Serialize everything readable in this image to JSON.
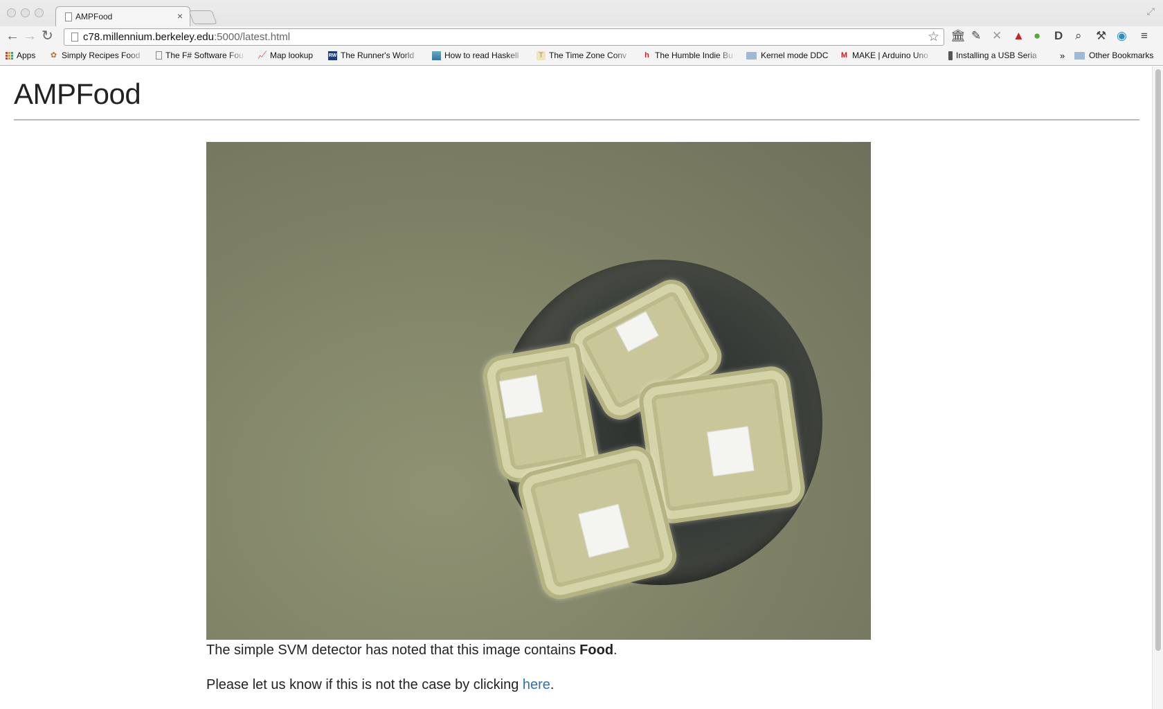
{
  "browser": {
    "tab_title": "AMPFood",
    "tab_close": "×",
    "url_host": "c78.millennium.berkeley.edu",
    "url_path": ":5000/latest.html",
    "bookmarks": [
      {
        "label": "Apps",
        "icon": "apps-grid-icon"
      },
      {
        "label": "Simply Recipes Food",
        "icon": "flower-icon"
      },
      {
        "label": "The F# Software Fou",
        "icon": "page-icon"
      },
      {
        "label": "Map lookup",
        "icon": "chart-icon"
      },
      {
        "label": "The Runner's World",
        "icon": "rw-icon"
      },
      {
        "label": "How to read Haskell",
        "icon": "image-icon"
      },
      {
        "label": "The Time Zone Conv",
        "icon": "clock-icon"
      },
      {
        "label": "The Humble Indie Bu",
        "icon": "humble-icon"
      },
      {
        "label": "Kernel mode DDC",
        "icon": "folder-icon"
      },
      {
        "label": "MAKE | Arduino Uno",
        "icon": "make-icon"
      },
      {
        "label": "Installing a USB Seria",
        "icon": "usb-icon"
      },
      {
        "label": "Other Bookmarks",
        "icon": "folder-icon"
      }
    ],
    "overflow": "»"
  },
  "page": {
    "title": "AMPFood",
    "caption_prefix": "The simple SVM detector has noted that this image contains ",
    "caption_class": "Food",
    "caption_suffix": ".",
    "feedback_prefix": "Please let us know if this is not the case by clicking ",
    "feedback_link": "here",
    "feedback_suffix": "."
  },
  "colors": {
    "link": "#2a6fb8",
    "container": "#c9c79a",
    "background": "#828468"
  }
}
